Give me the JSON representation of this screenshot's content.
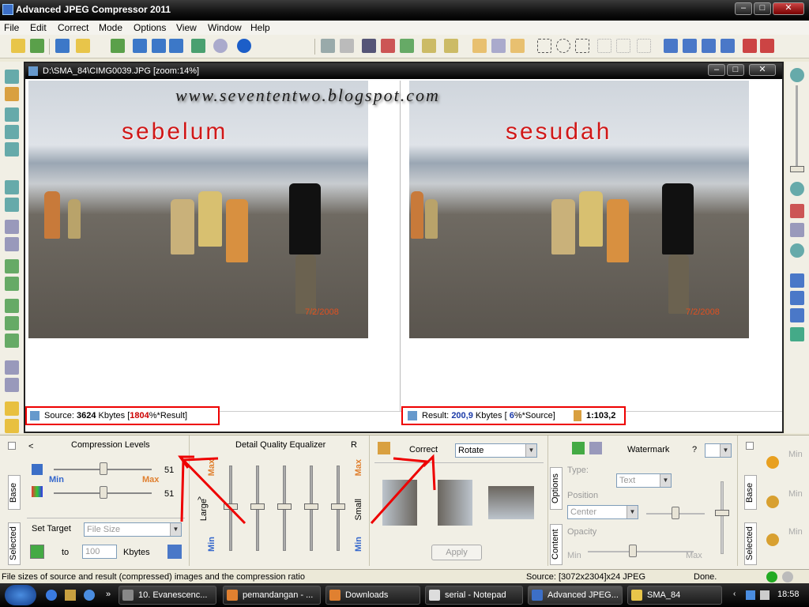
{
  "app": {
    "title": "Advanced JPEG Compressor 2011"
  },
  "menu": [
    "File",
    "Edit",
    "Correct",
    "Mode",
    "Options",
    "View",
    "Window",
    "Help"
  ],
  "document": {
    "title": "D:\\SMA_84\\CIMG0039.JPG  [zoom:14%]",
    "watermark_url": "www.sevententwo.blogspot.com",
    "left_label": "sebelum",
    "right_label": "sesudah",
    "photo_date": "7/2/2008"
  },
  "source_status": {
    "prefix": "Source:",
    "size": "3624",
    "unit": "Kbytes",
    "open": "[",
    "percent": "1804",
    "suffix": "%*Result]"
  },
  "result_status": {
    "prefix": "Result:",
    "size": "200,9",
    "unit": "Kbytes",
    "open": "[",
    "percent": "6",
    "suffix": "%*Source]",
    "ratio": "1:103,2"
  },
  "compression": {
    "tab_label": "Base",
    "tab_selected": "Selected",
    "header": "Compression Levels",
    "min": "Min",
    "max": "Max",
    "value1": "51",
    "value2": "51",
    "set_target_label": "Set Target",
    "target_mode": "File Size",
    "to_label": "to",
    "target_value": "100",
    "unit": "Kbytes",
    "collapse": "<"
  },
  "equalizer": {
    "header": "Detail Quality Equalizer",
    "r": "R",
    "large": "Large",
    "small": "Small",
    "min": "Min",
    "max": "Max",
    "caret": "^"
  },
  "correct": {
    "label": "Correct",
    "mode": "Rotate",
    "apply": "Apply"
  },
  "watermark": {
    "tab_options": "Options",
    "tab_content": "Content",
    "header": "Watermark",
    "help": "?",
    "type_label": "Type:",
    "type_value": "Text",
    "position_label": "Position",
    "position_value": "Center",
    "opacity_label": "Opacity",
    "min": "Min",
    "max": "Max"
  },
  "rightpanel": {
    "tab_base": "Base",
    "tab_selected": "Selected",
    "min1": "Min",
    "min2": "Min",
    "min3": "Min"
  },
  "statusline": {
    "hint": "File sizes of source and result (compressed) images and the compression ratio",
    "source_info": "Source: [3072x2304]x24 JPEG",
    "state": "Done."
  },
  "taskbar": {
    "tasks": [
      "10. Evanescenc...",
      "pemandangan - ...",
      "Downloads",
      "serial - Notepad",
      "Advanced JPEG...",
      "SMA_84"
    ],
    "clock": "18:58",
    "chevron": "»"
  }
}
